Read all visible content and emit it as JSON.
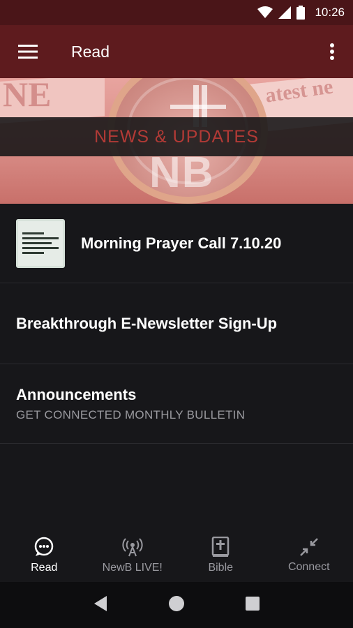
{
  "status_bar": {
    "time": "10:26"
  },
  "app_bar": {
    "title": "Read"
  },
  "banner": {
    "heading": "NEWS & UPDATES",
    "ghost_left": "NE",
    "ghost_right": "atest ne",
    "logo_text": "NB"
  },
  "list": {
    "items": [
      {
        "title": "Morning Prayer Call 7.10.20",
        "thumbnail": "sloth-quote-thumbnail"
      },
      {
        "title": "Breakthrough E-Newsletter Sign-Up"
      },
      {
        "title": "Announcements",
        "subtitle": "GET CONNECTED MONTHLY BULLETIN"
      }
    ]
  },
  "bottom_nav": {
    "tabs": [
      {
        "label": "Read",
        "icon": "chat-bubble-icon",
        "active": true
      },
      {
        "label": "NewB LIVE!",
        "icon": "broadcast-icon",
        "active": false
      },
      {
        "label": "Bible",
        "icon": "bible-icon",
        "active": false
      },
      {
        "label": "Connect",
        "icon": "connect-icon",
        "active": false
      }
    ]
  },
  "colors": {
    "status_bar": "#4a1518",
    "app_bar": "#5e1b1e",
    "background": "#17171a",
    "accent_red": "#b23a36"
  }
}
